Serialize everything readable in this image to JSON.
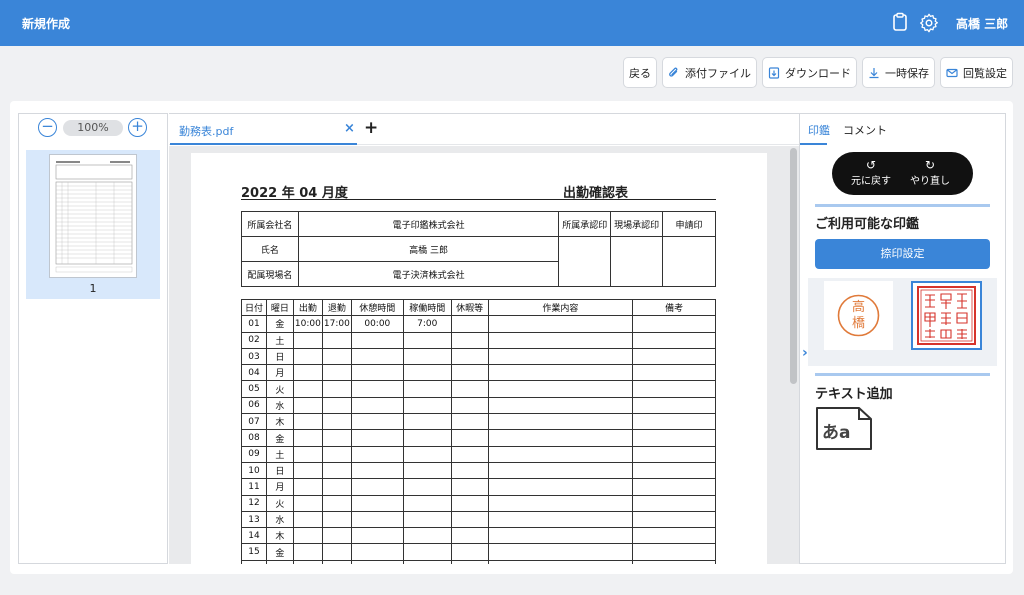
{
  "header": {
    "title": "新規作成",
    "user": "高橋 三郎"
  },
  "toolbar": {
    "back": "戻る",
    "attach": "添付ファイル",
    "download": "ダウンロード",
    "save_temp": "一時保存",
    "circulate": "回覧設定"
  },
  "thumbs": {
    "zoom": "100%",
    "page_number": "1"
  },
  "viewer": {
    "tab_name": "勤務表.pdf",
    "close": "×",
    "add": "+"
  },
  "doc": {
    "year_month": "2022 年 04 月度",
    "title": "出勤確認表",
    "info": {
      "company_label": "所属会社名",
      "company_value": "電子印鑑株式会社",
      "name_label": "氏名",
      "name_value": "高橋 三郎",
      "site_label": "配属現場名",
      "site_value": "電子決済株式会社",
      "approve1": "所属承認印",
      "approve2": "現場承認印",
      "applicant": "申請印"
    },
    "columns": [
      "日付",
      "曜日",
      "出勤",
      "退勤",
      "休憩時間",
      "稼働時間",
      "休暇等",
      "作業内容",
      "備考"
    ],
    "rows": [
      [
        "01",
        "金",
        "10:00",
        "17:00",
        "00:00",
        "7:00",
        "",
        "",
        ""
      ],
      [
        "02",
        "土",
        "",
        "",
        "",
        "",
        "",
        "",
        ""
      ],
      [
        "03",
        "日",
        "",
        "",
        "",
        "",
        "",
        "",
        ""
      ],
      [
        "04",
        "月",
        "",
        "",
        "",
        "",
        "",
        "",
        ""
      ],
      [
        "05",
        "火",
        "",
        "",
        "",
        "",
        "",
        "",
        ""
      ],
      [
        "06",
        "水",
        "",
        "",
        "",
        "",
        "",
        "",
        ""
      ],
      [
        "07",
        "木",
        "",
        "",
        "",
        "",
        "",
        "",
        ""
      ],
      [
        "08",
        "金",
        "",
        "",
        "",
        "",
        "",
        "",
        ""
      ],
      [
        "09",
        "土",
        "",
        "",
        "",
        "",
        "",
        "",
        ""
      ],
      [
        "10",
        "日",
        "",
        "",
        "",
        "",
        "",
        "",
        ""
      ],
      [
        "11",
        "月",
        "",
        "",
        "",
        "",
        "",
        "",
        ""
      ],
      [
        "12",
        "火",
        "",
        "",
        "",
        "",
        "",
        "",
        ""
      ],
      [
        "13",
        "水",
        "",
        "",
        "",
        "",
        "",
        "",
        ""
      ],
      [
        "14",
        "木",
        "",
        "",
        "",
        "",
        "",
        "",
        ""
      ],
      [
        "15",
        "金",
        "",
        "",
        "",
        "",
        "",
        "",
        ""
      ],
      [
        "",
        "",
        "",
        "",
        "",
        "",
        "",
        "",
        ""
      ]
    ]
  },
  "right": {
    "tab_stamp": "印鑑",
    "tab_comment": "コメント",
    "undo": "元に戻す",
    "redo": "やり直し",
    "available_stamps": "ご利用可能な印鑑",
    "stamp_settings": "捺印設定",
    "stamp1_text": "高橋",
    "add_text": "テキスト追加",
    "text_icon_label": "あa"
  },
  "colors": {
    "accent": "#3a85d8",
    "header": "#3a85d8",
    "stamp_red": "#d6332b",
    "stamp_orange": "#e07a3a"
  }
}
